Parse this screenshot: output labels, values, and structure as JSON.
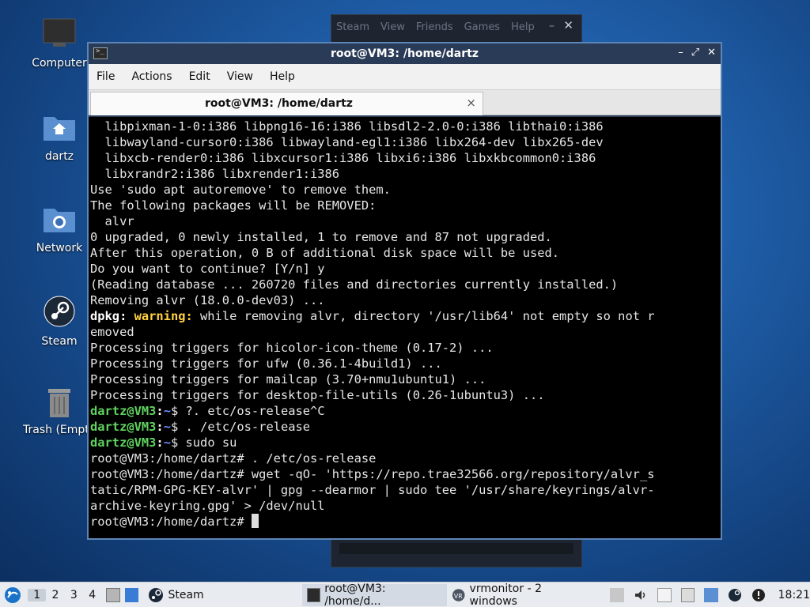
{
  "desktop": {
    "icons": [
      {
        "label": "Computer"
      },
      {
        "label": "dartz"
      },
      {
        "label": "Network"
      },
      {
        "label": "Steam"
      },
      {
        "label": "Trash (Empty)"
      }
    ]
  },
  "steam_window": {
    "menu": [
      "Steam",
      "View",
      "Friends",
      "Games",
      "Help"
    ],
    "minimize": "–",
    "close": "✕"
  },
  "terminal_window": {
    "title": "root@VM3: /home/dartz",
    "buttons": {
      "minimize": "–",
      "restore": "⤢",
      "close": "✕"
    },
    "menu": [
      "File",
      "Actions",
      "Edit",
      "View",
      "Help"
    ],
    "tab": {
      "title": "root@VM3: /home/dartz",
      "close": "×"
    },
    "lines": {
      "l1": "  libpixman-1-0:i386 libpng16-16:i386 libsdl2-2.0-0:i386 libthai0:i386",
      "l2": "  libwayland-cursor0:i386 libwayland-egl1:i386 libx264-dev libx265-dev",
      "l3": "  libxcb-render0:i386 libxcursor1:i386 libxi6:i386 libxkbcommon0:i386",
      "l4": "  libxrandr2:i386 libxrender1:i386",
      "l5": "Use 'sudo apt autoremove' to remove them.",
      "l6": "The following packages will be REMOVED:",
      "l7": "  alvr",
      "l8": "0 upgraded, 0 newly installed, 1 to remove and 87 not upgraded.",
      "l9": "After this operation, 0 B of additional disk space will be used.",
      "l10": "Do you want to continue? [Y/n] y",
      "l11": "(Reading database ... 260720 files and directories currently installed.)",
      "l12": "Removing alvr (18.0.0-dev03) ...",
      "l13_a": "dpkg: ",
      "l13_b": "warning: ",
      "l13_c": "while removing alvr, directory '/usr/lib64' not empty so not r",
      "l14": "emoved",
      "l15": "Processing triggers for hicolor-icon-theme (0.17-2) ...",
      "l16": "Processing triggers for ufw (0.36.1-4build1) ...",
      "l17": "Processing triggers for mailcap (3.70+nmu1ubuntu1) ...",
      "l18": "Processing triggers for desktop-file-utils (0.26-1ubuntu3) ...",
      "prompt_user": "dartz@VM3",
      "prompt_colon": ":",
      "prompt_path": "~",
      "prompt_sym": "$ ",
      "cmd1": "?. etc/os-release^C",
      "cmd2": ". /etc/os-release",
      "cmd3": "sudo su",
      "l22": "root@VM3:/home/dartz# . /etc/os-release",
      "l23": "root@VM3:/home/dartz# wget -qO- 'https://repo.trae32566.org/repository/alvr_s",
      "l24": "tatic/RPM-GPG-KEY-alvr' | gpg --dearmor | sudo tee '/usr/share/keyrings/alvr-",
      "l25": "archive-keyring.gpg' > /dev/null",
      "l26": "root@VM3:/home/dartz# "
    }
  },
  "taskbar": {
    "workspaces": [
      "1",
      "2",
      "3",
      "4"
    ],
    "tasks": [
      {
        "label": "Steam"
      },
      {
        "label": "root@VM3: /home/d..."
      },
      {
        "label": "vrmonitor - 2 windows"
      }
    ],
    "clock": "18:21"
  },
  "colors": {
    "prompt_green": "#5fd35f",
    "prompt_blue": "#6f8cff",
    "warning_yellow": "#ffd23f",
    "titlebar": "#2a3b57"
  }
}
